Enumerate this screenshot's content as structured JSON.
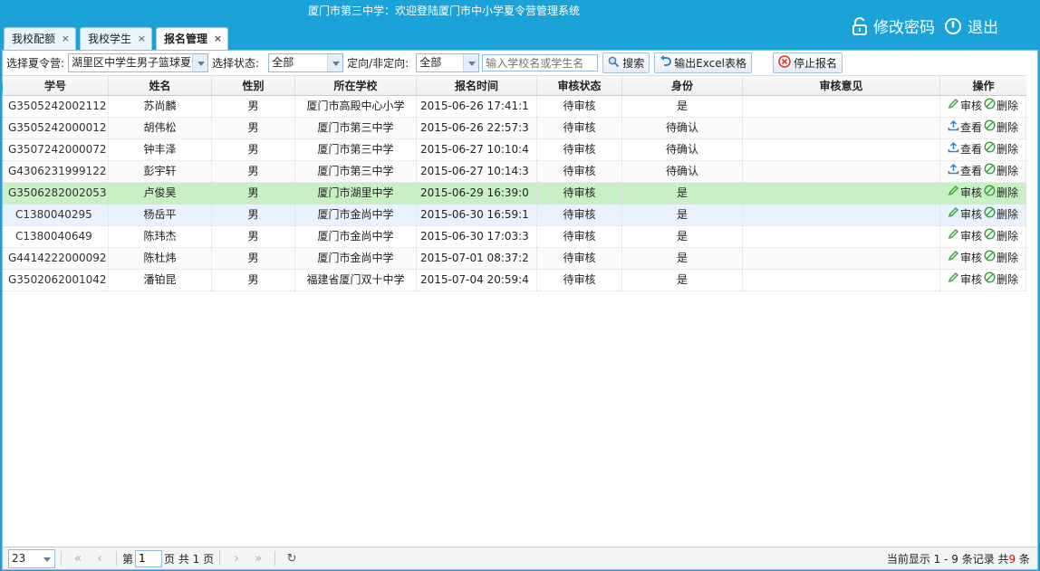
{
  "header": {
    "system_title": "厦门市第三中学：欢迎登陆厦门市中小学夏令营管理系统",
    "change_password": "修改密码",
    "logout": "退出"
  },
  "tabs": [
    {
      "label": "我校配额",
      "close": "×"
    },
    {
      "label": "我校学生",
      "close": "×"
    },
    {
      "label": "报名管理",
      "close": "×"
    }
  ],
  "filters": {
    "camp_label": "选择夏令营:",
    "camp_value": "湖里区中学生男子篮球夏令营",
    "status_label": "选择状态:",
    "status_value": "全部",
    "targeted_label": "定向/非定向:",
    "targeted_value": "全部",
    "search_placeholder": "输入学校名或学生名",
    "search_button": "搜索",
    "export_button": "输出Excel表格",
    "stop_button": "停止报名"
  },
  "grid": {
    "columns": [
      "学号",
      "姓名",
      "性别",
      "所在学校",
      "报名时间",
      "审核状态",
      "身份",
      "审核意见",
      "操作"
    ],
    "rows": [
      {
        "id": "G3505242002112",
        "name": "苏尚麟",
        "gender": "男",
        "school": "厦门市高殿中心小学",
        "time": "2015-06-26 17:41:1",
        "status": "待审核",
        "identity": "是",
        "opinion": "",
        "op1": "审核",
        "op1_icon": "pencil-icon",
        "op2": "删除"
      },
      {
        "id": "G3505242000012",
        "name": "胡伟松",
        "gender": "男",
        "school": "厦门市第三中学",
        "time": "2015-06-26 22:57:3",
        "status": "待审核",
        "identity": "待确认",
        "opinion": "",
        "op1": "查看",
        "op1_icon": "upload-icon",
        "op2": "删除"
      },
      {
        "id": "G3507242000072",
        "name": "钟丰泽",
        "gender": "男",
        "school": "厦门市第三中学",
        "time": "2015-06-27 10:10:4",
        "status": "待审核",
        "identity": "待确认",
        "opinion": "",
        "op1": "查看",
        "op1_icon": "upload-icon",
        "op2": "删除"
      },
      {
        "id": "G4306231999122",
        "name": "彭宇轩",
        "gender": "男",
        "school": "厦门市第三中学",
        "time": "2015-06-27 10:14:3",
        "status": "待审核",
        "identity": "待确认",
        "opinion": "",
        "op1": "查看",
        "op1_icon": "upload-icon",
        "op2": "删除"
      },
      {
        "id": "G3506282002053",
        "name": "卢俊昊",
        "gender": "男",
        "school": "厦门市湖里中学",
        "time": "2015-06-29 16:39:0",
        "status": "待审核",
        "identity": "是",
        "opinion": "",
        "op1": "审核",
        "op1_icon": "pencil-icon",
        "op2": "删除"
      },
      {
        "id": "C1380040295",
        "name": "杨岳平",
        "gender": "男",
        "school": "厦门市金尚中学",
        "time": "2015-06-30 16:59:1",
        "status": "待审核",
        "identity": "是",
        "opinion": "",
        "op1": "审核",
        "op1_icon": "pencil-icon",
        "op2": "删除"
      },
      {
        "id": "C1380040649",
        "name": "陈玮杰",
        "gender": "男",
        "school": "厦门市金尚中学",
        "time": "2015-06-30 17:03:3",
        "status": "待审核",
        "identity": "是",
        "opinion": "",
        "op1": "审核",
        "op1_icon": "pencil-icon",
        "op2": "删除"
      },
      {
        "id": "G4414222000092",
        "name": "陈杜炜",
        "gender": "男",
        "school": "厦门市金尚中学",
        "time": "2015-07-01 08:37:2",
        "status": "待审核",
        "identity": "是",
        "opinion": "",
        "op1": "审核",
        "op1_icon": "pencil-icon",
        "op2": "删除"
      },
      {
        "id": "G3502062001042",
        "name": "潘铂昆",
        "gender": "男",
        "school": "福建省厦门双十中学",
        "time": "2015-07-04 20:59:4",
        "status": "待审核",
        "identity": "是",
        "opinion": "",
        "op1": "审核",
        "op1_icon": "pencil-icon",
        "op2": "删除"
      }
    ]
  },
  "pager": {
    "page_size": "23",
    "page_prefix": "第",
    "page_value": "1",
    "page_suffix": "页 共 1 页",
    "info_prefix": "当前显示 1 - 9 条记录 共",
    "info_total": "9",
    "info_suffix": " 条"
  },
  "colors": {
    "header": "#1ba3d9",
    "selected_row": "#c8f0c4",
    "hover_row": "#eaf2ff",
    "ok_green": "#3aa83a",
    "total_red": "#e00000"
  }
}
